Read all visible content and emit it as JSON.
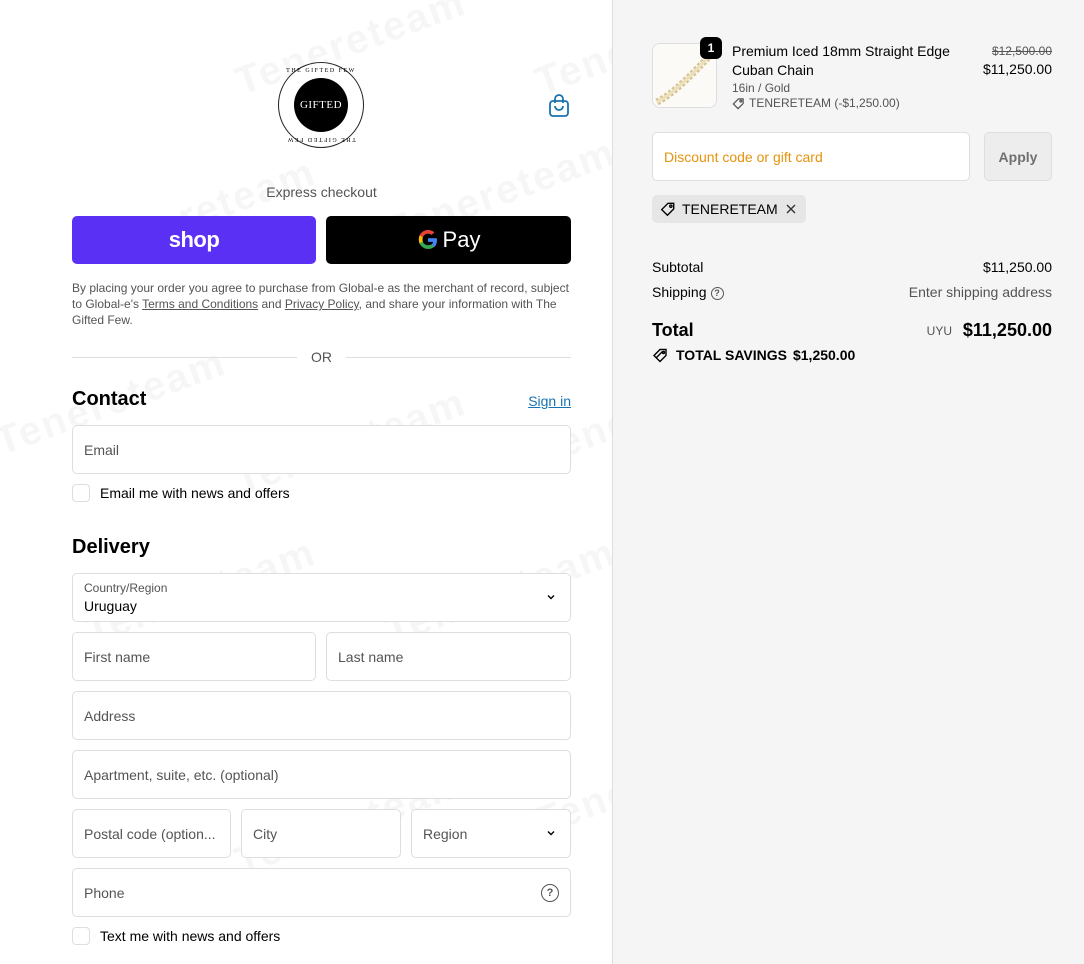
{
  "brand": {
    "logo_text": "GIFTED",
    "logo_ring": "THE GIFTED FEW"
  },
  "express": {
    "label": "Express checkout",
    "shop_label": "shop",
    "gpay_label": "Pay"
  },
  "legal": {
    "part1": "By placing your order you agree to purchase from Global-e as the merchant of record, subject to Global-e's ",
    "terms": "Terms and Conditions",
    "and": " and ",
    "privacy": "Privacy Policy",
    "part2": ", and share your information with The Gifted Few."
  },
  "or_label": "OR",
  "contact": {
    "heading": "Contact",
    "sign_in": "Sign in",
    "email_placeholder": "Email",
    "news_label": "Email me with news and offers"
  },
  "delivery": {
    "heading": "Delivery",
    "country_label": "Country/Region",
    "country_value": "Uruguay",
    "first_name": "First name",
    "last_name": "Last name",
    "address": "Address",
    "apartment": "Apartment, suite, etc. (optional)",
    "postal": "Postal code (option...",
    "city": "City",
    "region": "Region",
    "phone": "Phone",
    "sms_label": "Text me with news and offers"
  },
  "cart": {
    "quantity": "1",
    "product_title": "Premium Iced 18mm Straight Edge Cuban Chain",
    "variant": "16in / Gold",
    "discount_line": "TENERETEAM (-$1,250.00)",
    "price_old": "$12,500.00",
    "price_new": "$11,250.00"
  },
  "discount": {
    "placeholder": "Discount code or gift card",
    "apply": "Apply",
    "applied_code": "TENERETEAM"
  },
  "summary": {
    "subtotal_label": "Subtotal",
    "subtotal_value": "$11,250.00",
    "shipping_label": "Shipping",
    "shipping_value": "Enter shipping address",
    "total_label": "Total",
    "currency": "UYU",
    "total_value": "$11,250.00",
    "savings_label": "TOTAL SAVINGS",
    "savings_value": "$1,250.00"
  },
  "watermark": "Tenereteam",
  "colors": {
    "shop_purple": "#5a31f4",
    "link_blue": "#1773b0",
    "placeholder_orange": "#e5930b",
    "summary_bg": "#f5f5f5"
  },
  "icons": {
    "cart": "shopping-bag-icon",
    "chevron": "chevron-down-icon",
    "help": "question-circle-icon",
    "tag": "tag-icon",
    "close": "close-icon",
    "savings": "savings-tag-icon"
  }
}
